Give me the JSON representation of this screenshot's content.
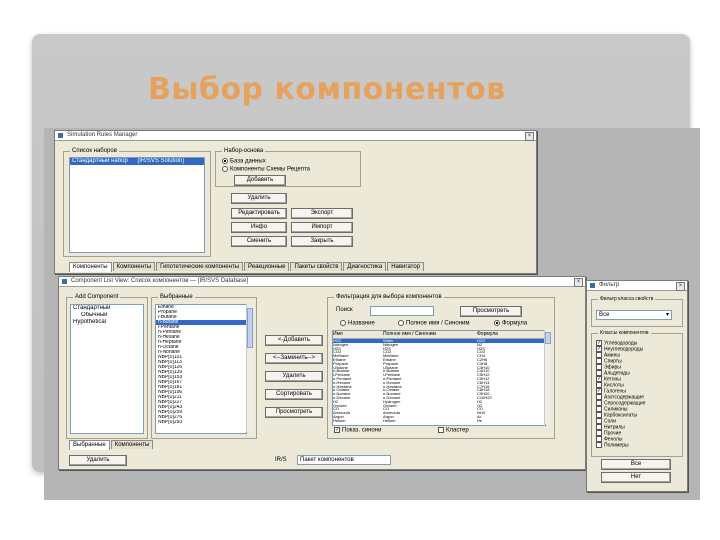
{
  "slide": {
    "title": "Выбор компонентов"
  },
  "win1": {
    "title": "Simulation Rules Manager",
    "group_label": "Список наборов",
    "list_items": [
      {
        "a": "Стандартный набор",
        "b": "[IR/SVS Solution]"
      }
    ],
    "source_group": "Набор-основа",
    "radio1": "База данных",
    "radio2": "Компоненты Схемы Рецепта",
    "add_btn": "Добавить",
    "delete_btn": "Удалить",
    "edit_btn": "Редактировать",
    "export_btn": "Экспорт",
    "help_btn": "Инфо",
    "import_btn": "Импорт",
    "default_btn": "Сменить",
    "close_btn": "Закрыть",
    "tabs": [
      "Компоненты",
      "Компоненты",
      "Гипотетические компоненты",
      "Реакционные",
      "Пакеты свойств",
      "Диагностика",
      "Навигатор"
    ]
  },
  "win2": {
    "title": "Component List View: Список компонентов — [IR/SVS Database]",
    "added_group": "Add Component",
    "tree": [
      "Стандартный",
      "Обычный",
      "Hypothetical"
    ],
    "selected_group": "Выбранные",
    "sel_items": [
      "Ethane",
      "Propane",
      "i-Butane",
      "n-Butane",
      "i-Pentane",
      "n-Pentane",
      "n-Hexane",
      "n-Heptane",
      "n-Octane",
      "n-Nonane",
      "NBP[0]101",
      "NBP[0]113",
      "NBP[0]126",
      "NBP[0]139",
      "NBP[0]153",
      "NBP[0]167",
      "NBP[0]181",
      "NBP[0]196",
      "NBP[0]211",
      "NBP[0]227",
      "NBP[0]243",
      "NBP[0]259",
      "NBP[0]276",
      "NBP[0]293"
    ],
    "add_btn": "<-Добавить",
    "replace_btn": "<--Заменить-->",
    "remove_btn": "Удалить",
    "sort_btn": "Сортировать",
    "clean_btn": "Просмотреть",
    "filter_group": "Фильтрация для выбора компонентов",
    "match_label": "Поиск",
    "match_value": "",
    "view_btn": "Просмотреть",
    "radio_sim": "Название",
    "radio_full": "Полное имя / Синоним",
    "radio_formula": "Формула",
    "table_head": [
      "Имя",
      "Полное имя / Синоним",
      "Формула"
    ],
    "table_rows": [
      {
        "a": "H2O",
        "b": "Water",
        "c": "H2O",
        "sel": true
      },
      {
        "a": "Nitrogen",
        "b": "Nitrogen",
        "c": "N2"
      },
      {
        "a": "H2S",
        "b": "H2S",
        "c": "H2S"
      },
      {
        "a": "CO2",
        "b": "CO2",
        "c": "CO2"
      },
      {
        "a": "Methane",
        "b": "Methane",
        "c": "CH4"
      },
      {
        "a": "Ethane",
        "b": "Ethane",
        "c": "C2H6"
      },
      {
        "a": "Propane",
        "b": "Propane",
        "c": "C3H8"
      },
      {
        "a": "i-Butane",
        "b": "i-Butane",
        "c": "C4H10"
      },
      {
        "a": "n-Butane",
        "b": "n-Butane",
        "c": "C4H10"
      },
      {
        "a": "i-Pentane",
        "b": "i-Pentane",
        "c": "C5H12"
      },
      {
        "a": "n-Pentane",
        "b": "n-Pentane",
        "c": "C5H12"
      },
      {
        "a": "n-Hexane",
        "b": "n-Hexane",
        "c": "C6H14"
      },
      {
        "a": "n-Heptane",
        "b": "n-Heptane",
        "c": "C7H16"
      },
      {
        "a": "n-Octane",
        "b": "n-Octane",
        "c": "C8H18"
      },
      {
        "a": "n-Nonane",
        "b": "n-Nonane",
        "c": "C9H20"
      },
      {
        "a": "n-Decane",
        "b": "n-Decane",
        "c": "C10H22"
      },
      {
        "a": "H2",
        "b": "Hydrogen",
        "c": "H2"
      },
      {
        "a": "Oxygen",
        "b": "Oxygen",
        "c": "O2"
      },
      {
        "a": "CO",
        "b": "CO",
        "c": "CO"
      },
      {
        "a": "Ammonia",
        "b": "Ammonia",
        "c": "NH3"
      },
      {
        "a": "Argon",
        "b": "Argon",
        "c": "Ar"
      },
      {
        "a": "Helium",
        "b": "Helium",
        "c": "He"
      }
    ],
    "show_synonyms": "Показ. синони",
    "cluster": "Кластер",
    "tabs": [
      "Выбранные",
      "Компоненты"
    ],
    "delete_btn": "Удалить",
    "pkg_label": "IR/S",
    "pkg_value": "Пакет компонентов"
  },
  "win3": {
    "title": "Фильтр",
    "group1": "Фильтр класса свойств",
    "dropdown": "Все",
    "group2": "Классы компонентов",
    "classes": [
      {
        "label": "Углеводороды",
        "checked": true
      },
      {
        "label": "Неуглеводороды",
        "checked": true
      },
      {
        "label": "Амины",
        "checked": false
      },
      {
        "label": "Спирты",
        "checked": false
      },
      {
        "label": "Эфиры",
        "checked": false
      },
      {
        "label": "Альдегиды",
        "checked": false
      },
      {
        "label": "Кетоны",
        "checked": true
      },
      {
        "label": "Кислоты",
        "checked": false
      },
      {
        "label": "Галогены",
        "checked": true
      },
      {
        "label": "Азотсодержащие",
        "checked": false
      },
      {
        "label": "Серосодержащие",
        "checked": false
      },
      {
        "label": "Силиконы",
        "checked": false
      },
      {
        "label": "Карбоксилаты",
        "checked": false
      },
      {
        "label": "Соли",
        "checked": false
      },
      {
        "label": "Нитрилы",
        "checked": false
      },
      {
        "label": "Прочие",
        "checked": false
      },
      {
        "label": "Фенолы",
        "checked": false
      },
      {
        "label": "Полимеры",
        "checked": false
      }
    ],
    "all_btn": "Все",
    "none_btn": "Нет",
    "invert_btn": "Инвертировать"
  }
}
